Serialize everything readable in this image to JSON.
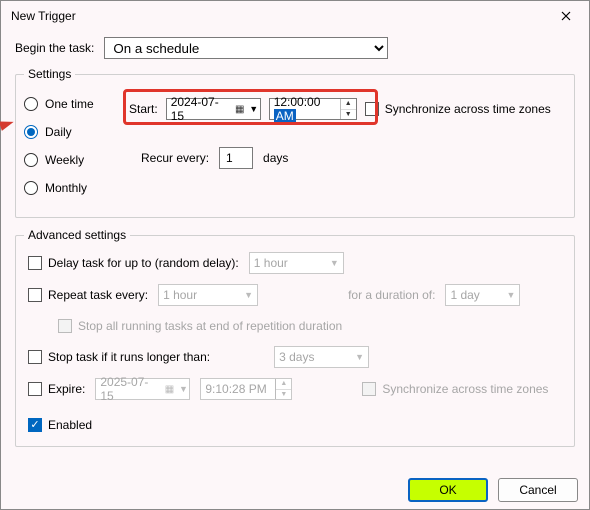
{
  "window": {
    "title": "New Trigger"
  },
  "begin": {
    "label": "Begin the task:",
    "value": "On a schedule"
  },
  "settings": {
    "legend": "Settings",
    "frequencies": {
      "one_time": "One time",
      "daily": "Daily",
      "weekly": "Weekly",
      "monthly": "Monthly",
      "selected": "daily"
    },
    "start": {
      "label": "Start:",
      "date": "2024-07-15",
      "time_prefix": "12:00:00",
      "time_ampm": "AM"
    },
    "sync_tz": {
      "label": "Synchronize across time zones",
      "checked": false
    },
    "recur": {
      "label": "Recur every:",
      "value": "1",
      "unit": "days"
    }
  },
  "advanced": {
    "legend": "Advanced settings",
    "delay": {
      "label": "Delay task for up to (random delay):",
      "value": "1 hour",
      "checked": false
    },
    "repeat": {
      "label": "Repeat task every:",
      "value": "1 hour",
      "checked": false,
      "duration_label": "for a duration of:",
      "duration_value": "1 day",
      "stop_all_label": "Stop all running tasks at end of repetition duration"
    },
    "stop_if": {
      "label": "Stop task if it runs longer than:",
      "value": "3 days",
      "checked": false
    },
    "expire": {
      "label": "Expire:",
      "date": "2025-07-15",
      "time": "9:10:28 PM",
      "checked": false,
      "sync_label": "Synchronize across time zones"
    },
    "enabled": {
      "label": "Enabled",
      "checked": true
    }
  },
  "buttons": {
    "ok": "OK",
    "cancel": "Cancel"
  }
}
